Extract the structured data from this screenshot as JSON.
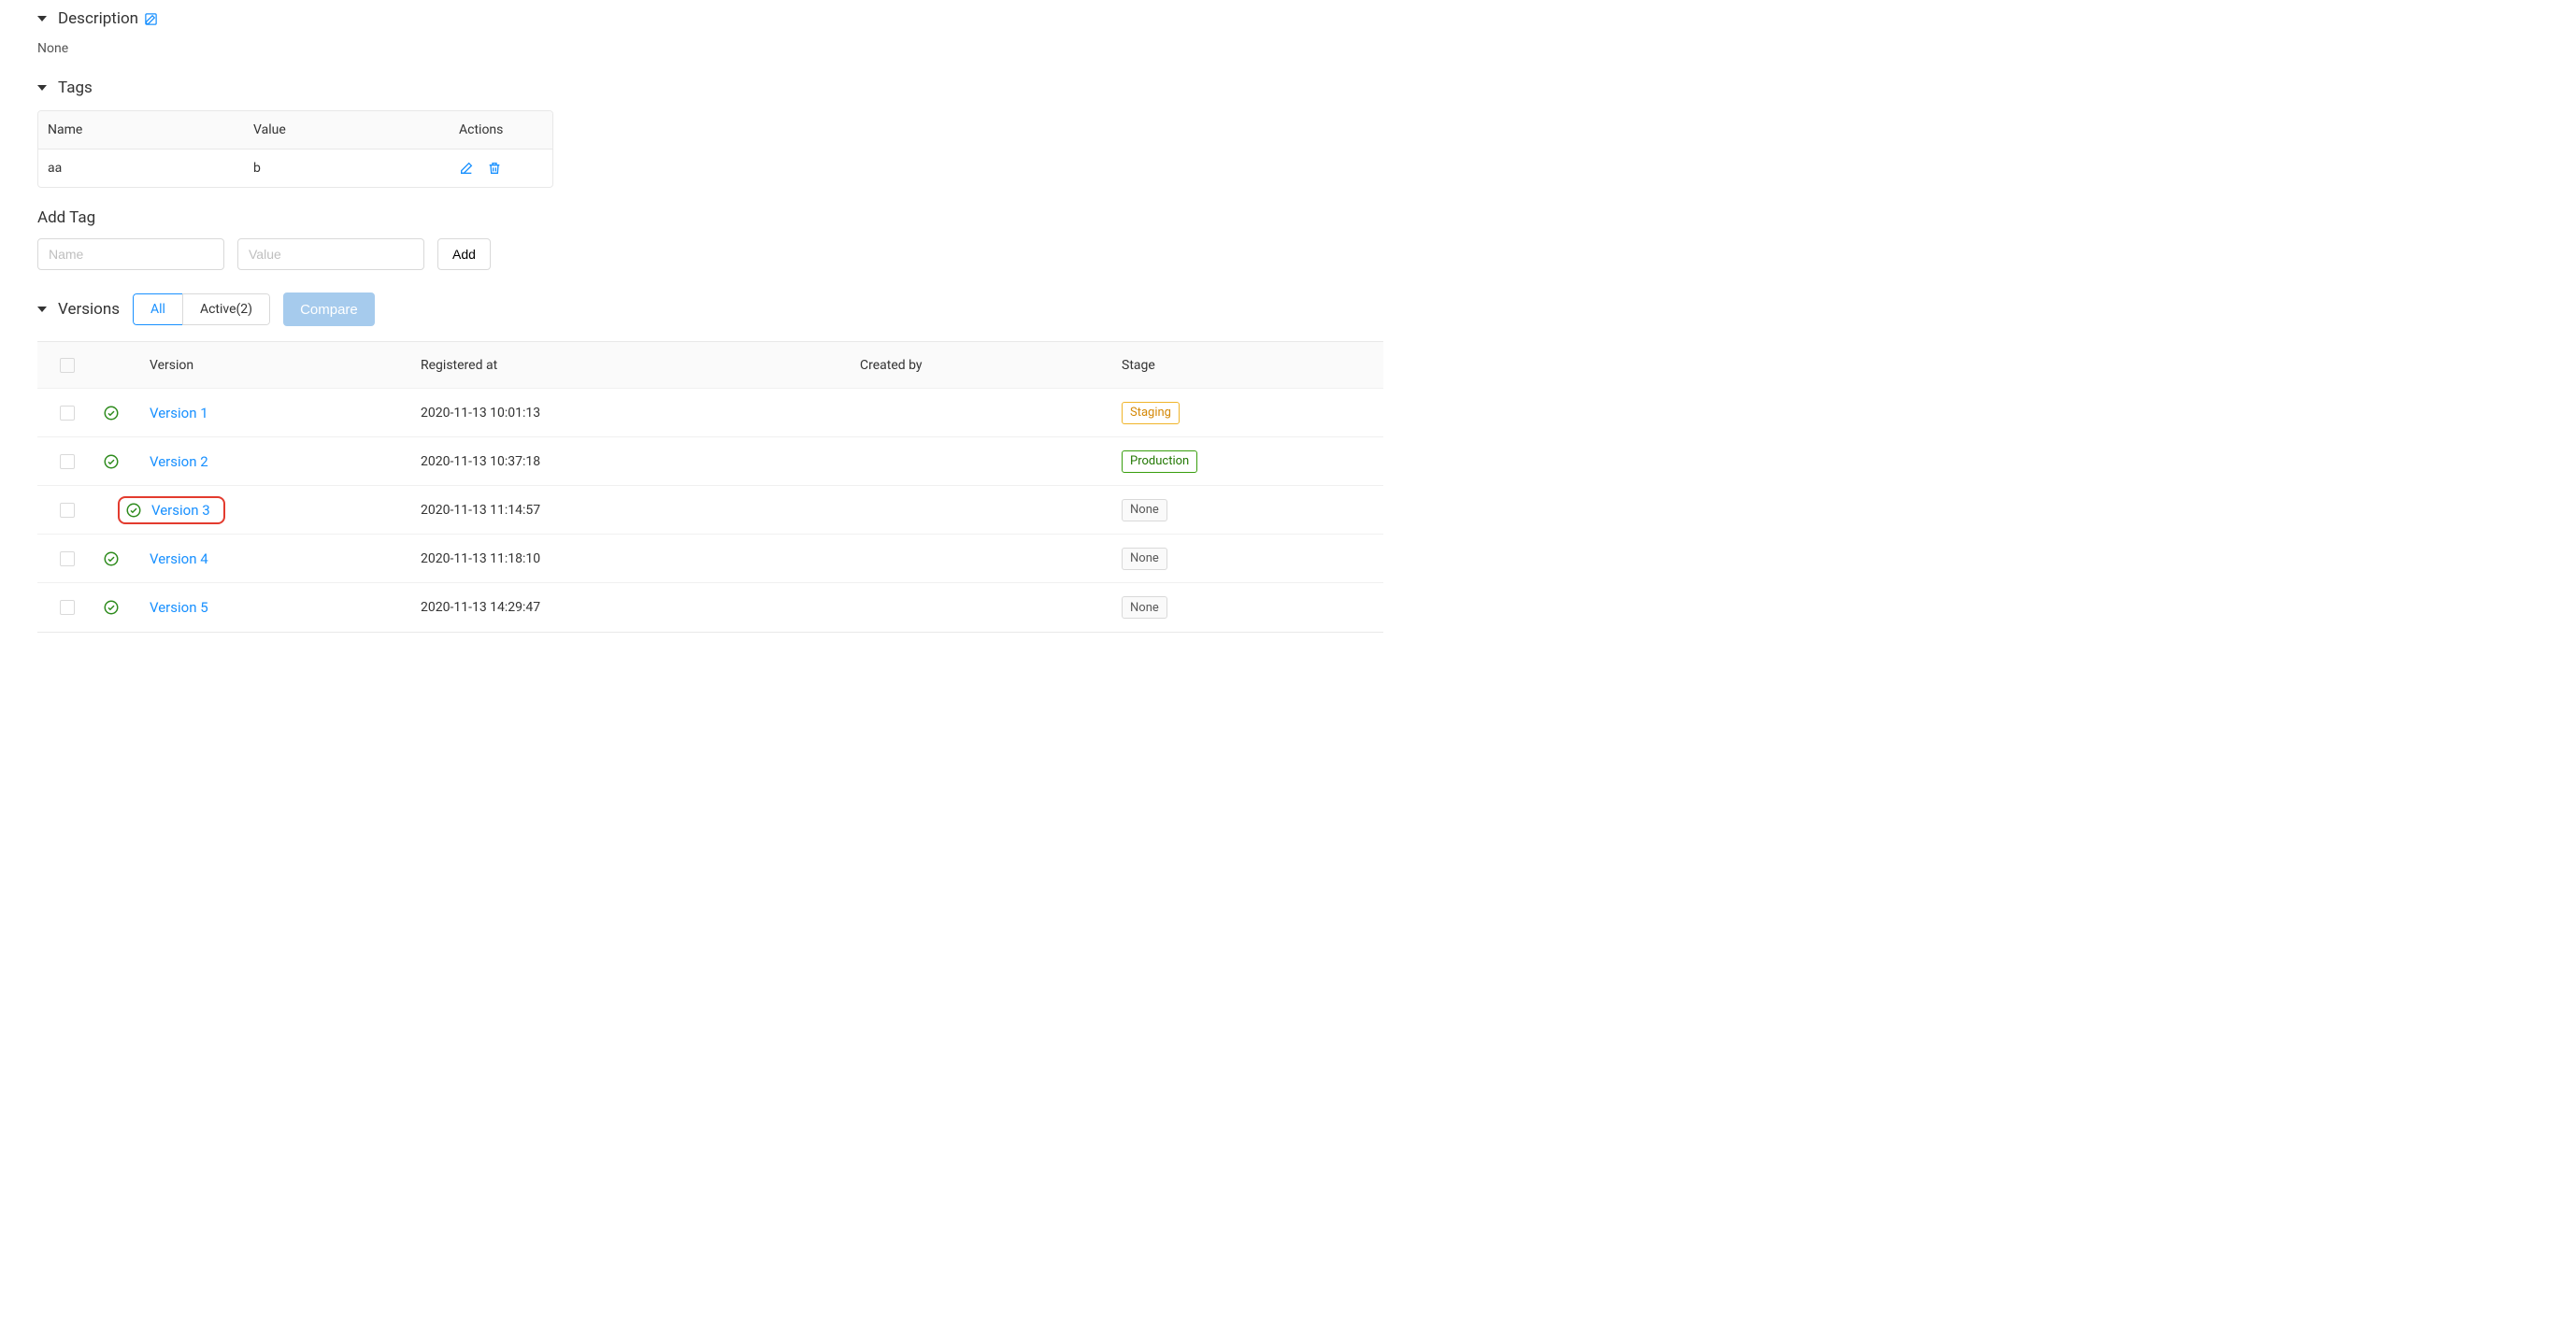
{
  "description": {
    "heading": "Description",
    "value": "None"
  },
  "tags": {
    "heading": "Tags",
    "columns": {
      "name": "Name",
      "value": "Value",
      "actions": "Actions"
    },
    "rows": [
      {
        "name": "aa",
        "value": "b"
      }
    ],
    "add_tag": {
      "title": "Add Tag",
      "name_placeholder": "Name",
      "value_placeholder": "Value",
      "add_label": "Add"
    }
  },
  "versions": {
    "heading": "Versions",
    "filters": {
      "all": "All",
      "active": "Active(2)"
    },
    "compare_label": "Compare",
    "columns": {
      "version": "Version",
      "registered_at": "Registered at",
      "created_by": "Created by",
      "stage": "Stage"
    },
    "rows": [
      {
        "name": "Version 1",
        "registered_at": "2020-11-13 10:01:13",
        "created_by": "",
        "stage": "Staging",
        "stage_class": "staging",
        "highlighted": false
      },
      {
        "name": "Version 2",
        "registered_at": "2020-11-13 10:37:18",
        "created_by": "",
        "stage": "Production",
        "stage_class": "production",
        "highlighted": false
      },
      {
        "name": "Version 3",
        "registered_at": "2020-11-13 11:14:57",
        "created_by": "",
        "stage": "None",
        "stage_class": "none",
        "highlighted": true
      },
      {
        "name": "Version 4",
        "registered_at": "2020-11-13 11:18:10",
        "created_by": "",
        "stage": "None",
        "stage_class": "none",
        "highlighted": false
      },
      {
        "name": "Version 5",
        "registered_at": "2020-11-13 14:29:47",
        "created_by": "",
        "stage": "None",
        "stage_class": "none",
        "highlighted": false
      }
    ]
  }
}
